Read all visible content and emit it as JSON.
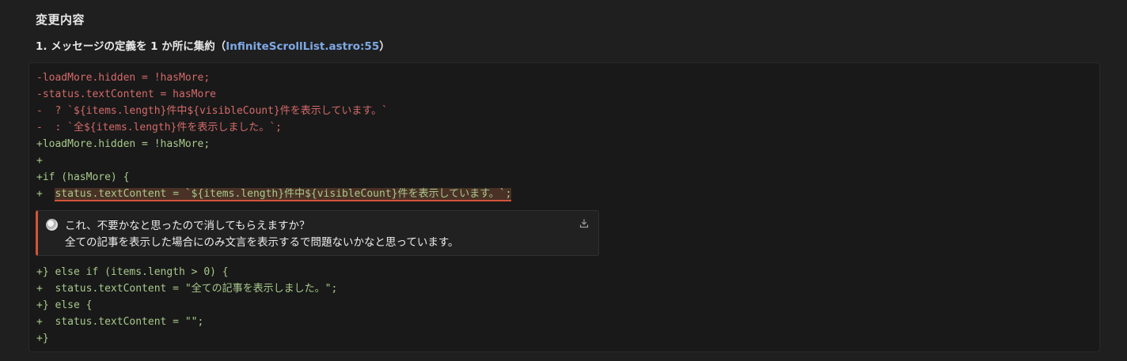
{
  "section": {
    "title": "変更内容"
  },
  "change": {
    "heading_prefix": "1. メッセージの定義を 1 か所に集約（",
    "file_link": "InfiniteScrollList.astro:55",
    "heading_suffix": "）"
  },
  "diff": {
    "lines_before_comment": [
      {
        "type": "del",
        "text": "-loadMore.hidden = !hasMore;"
      },
      {
        "type": "del",
        "text": "-status.textContent = hasMore"
      },
      {
        "type": "del",
        "text": "-  ? `${items.length}件中${visibleCount}件を表示しています。`"
      },
      {
        "type": "del",
        "text": "-  : `全${items.length}件を表示しました。`;"
      },
      {
        "type": "add",
        "text": "+loadMore.hidden = !hasMore;"
      },
      {
        "type": "add",
        "text": "+"
      },
      {
        "type": "add",
        "text": "+if (hasMore) {"
      }
    ],
    "highlighted_line": {
      "prefix": "+  ",
      "text": "status.textContent = `${items.length}件中${visibleCount}件を表示しています。`;"
    },
    "lines_after_comment": [
      {
        "type": "add",
        "text": "+} else if (items.length > 0) {"
      },
      {
        "type": "add",
        "text": "+  status.textContent = \"全ての記事を表示しました。\";"
      },
      {
        "type": "add",
        "text": "+} else {"
      },
      {
        "type": "add",
        "text": "+  status.textContent = \"\";"
      },
      {
        "type": "add",
        "text": "+}"
      }
    ]
  },
  "comment": {
    "line1": "これ、不要かなと思ったので消してもらえますか？",
    "line2": "全ての記事を表示した場合にのみ文言を表示するで問題ないかなと思っています。",
    "download_icon": "download-icon"
  }
}
